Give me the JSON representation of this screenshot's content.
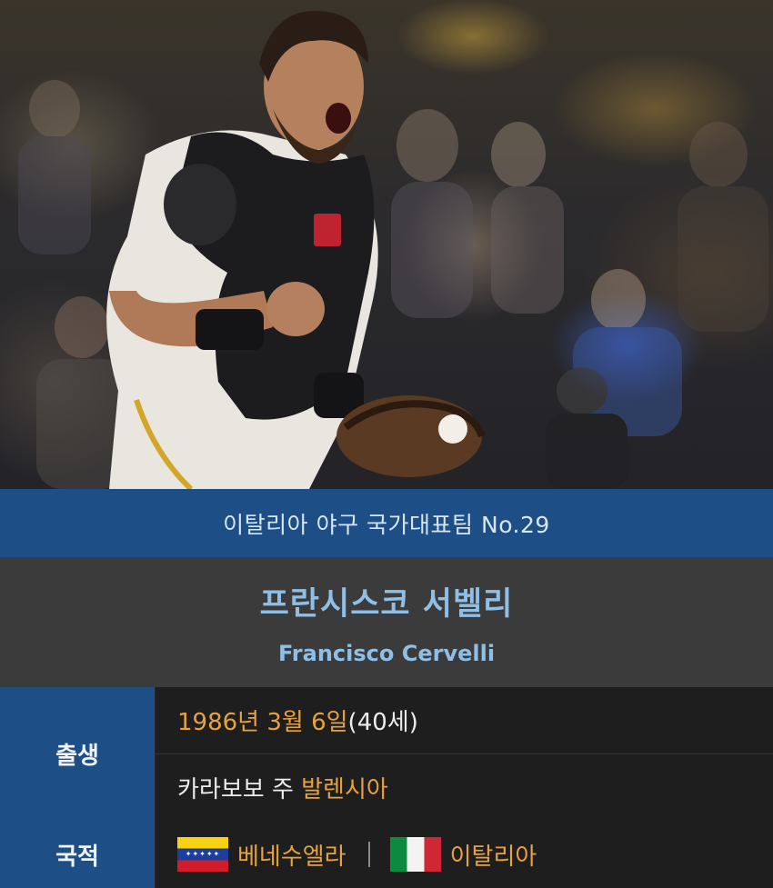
{
  "banner": {
    "text": "이탈리아 야구 국가대표팀 No.29"
  },
  "player": {
    "name_ko": "프란시스코 서벨리",
    "name_en": "Francisco Cervelli"
  },
  "info": {
    "birth": {
      "label": "출생",
      "date": "1986년 3월 6일",
      "age": " (40세)",
      "place_prefix": "카라보보 주 ",
      "place_city": "발렌시아"
    },
    "nationality": {
      "label": "국적",
      "countries": [
        "베네수엘라",
        "이탈리아"
      ],
      "flag_icons": [
        "venezuela-flag-icon",
        "italy-flag-icon"
      ]
    }
  },
  "colors": {
    "banner": "#1d4f86",
    "name_text": "#8fbfe6",
    "accent": "#e8a23c"
  }
}
